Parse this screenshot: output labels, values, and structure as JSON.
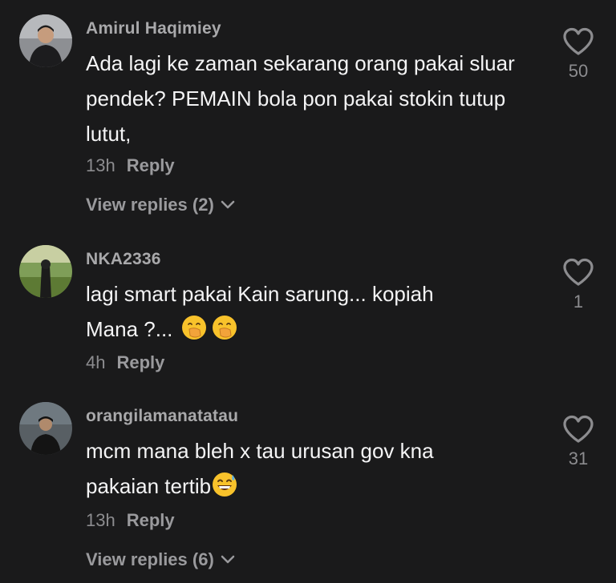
{
  "comments": [
    {
      "username": "Amirul Haqimiey",
      "text": "Ada lagi ke zaman sekarang orang pakai sluar pendek? PEMAIN bola pon pakai stokin tutup lutut,",
      "time": "13h",
      "reply_label": "Reply",
      "view_replies": "View replies (2)",
      "likes": "50"
    },
    {
      "username": "NKA2336",
      "text_line1": "lagi smart pakai Kain sarung... kopiah",
      "text_line2": "Mana ?...",
      "emoji": "face-with-hand-over-mouth",
      "time": "4h",
      "reply_label": "Reply",
      "likes": "1"
    },
    {
      "username": "orangilamanatatau",
      "text_line1": "mcm mana bleh x tau urusan gov kna",
      "text_line2": "pakaian tertib",
      "emoji": "grinning-face-with-sweat",
      "time": "13h",
      "reply_label": "Reply",
      "view_replies": "View replies (6)",
      "likes": "31"
    }
  ],
  "icons": {
    "like": "heart-outline-icon",
    "expand": "chevron-down-icon"
  },
  "colors": {
    "background": "#1a1a1b",
    "username": "#a9a9ab",
    "text": "#f4f4f5",
    "meta": "#8c8c8f"
  }
}
